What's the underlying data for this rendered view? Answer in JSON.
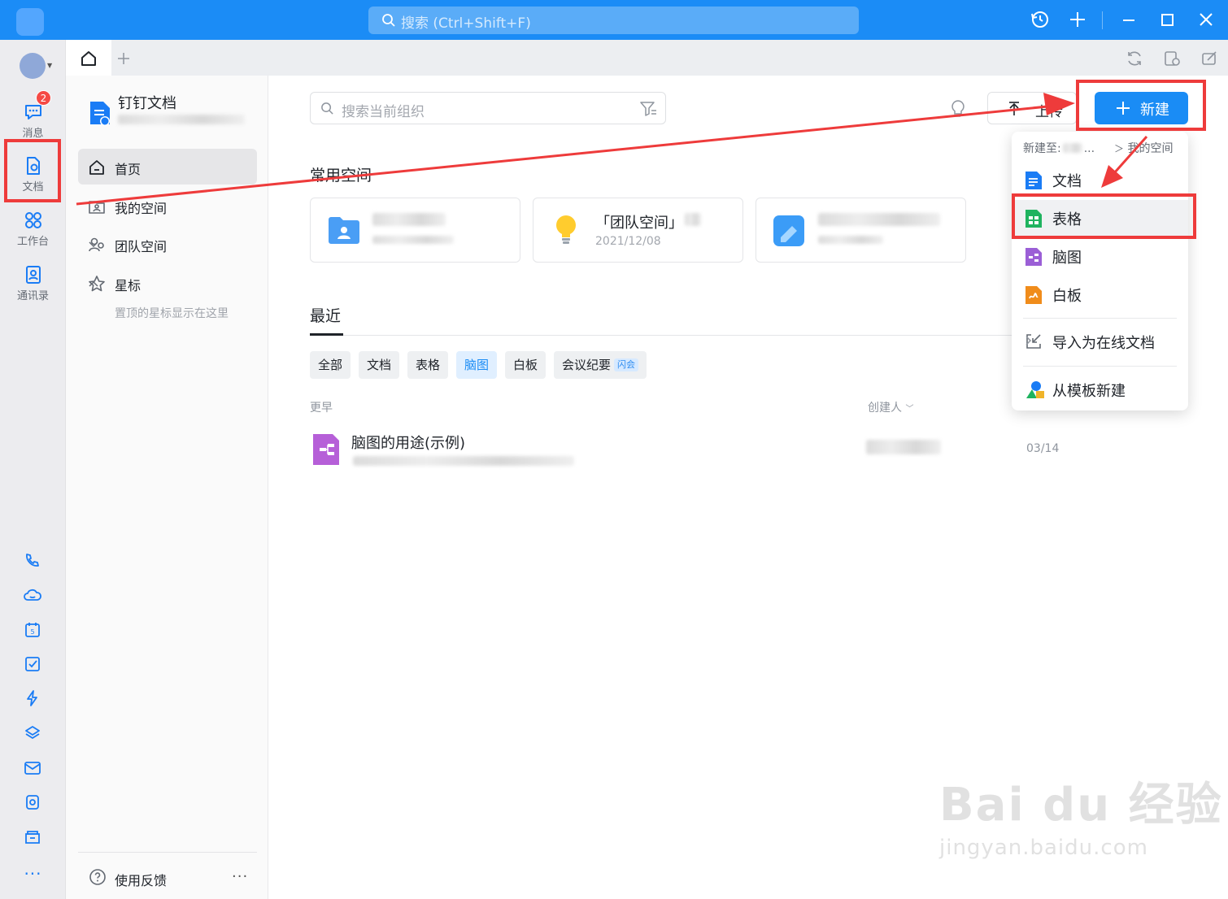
{
  "titlebar": {
    "search_placeholder": "搜索 (Ctrl+Shift+F)"
  },
  "rail": {
    "message_badge": "2",
    "items": [
      {
        "label": "消息"
      },
      {
        "label": "文档"
      },
      {
        "label": "工作台"
      },
      {
        "label": "通讯录"
      }
    ],
    "more": "···"
  },
  "side": {
    "title": "钉钉文档",
    "nav": [
      {
        "label": "首页"
      },
      {
        "label": "我的空间"
      },
      {
        "label": "团队空间"
      },
      {
        "label": "星标"
      }
    ],
    "star_hint": "置顶的星标显示在这里",
    "feedback": "使用反馈",
    "more": "···"
  },
  "main": {
    "org_search_placeholder": "搜索当前组织",
    "upload_label": "上传",
    "new_label": "新建",
    "common_spaces_title": "常用空间",
    "space_cards": [
      {
        "title": "",
        "date": ""
      },
      {
        "title": "「团队空间」",
        "date": "2021/12/08"
      },
      {
        "title": "",
        "date": ""
      }
    ],
    "recent_title": "最近",
    "filters": [
      "全部",
      "文档",
      "表格",
      "脑图",
      "白板",
      "会议纪要"
    ],
    "filter_tag": "闪会",
    "active_filter": "脑图",
    "group_label": "更早",
    "creator_header": "创建人",
    "files": [
      {
        "name": "脑图的用途(示例)",
        "date": "03/14"
      }
    ]
  },
  "menu": {
    "path_prefix": "新建至:",
    "path_ellipsis": "...",
    "path_target": "我的空间",
    "items": [
      {
        "label": "文档",
        "color": "#1a7cf5"
      },
      {
        "label": "表格",
        "color": "#1fb35f"
      },
      {
        "label": "脑图",
        "color": "#9b5fd6"
      },
      {
        "label": "白板",
        "color": "#f08c1b"
      }
    ],
    "import_label": "导入为在线文档",
    "template_label": "从模板新建"
  },
  "watermark": {
    "brand": "Bai du 经验",
    "url": "jingyan.baidu.com"
  },
  "colors": {
    "accent": "#1a8cf5",
    "annotation": "#ee3b3b"
  }
}
